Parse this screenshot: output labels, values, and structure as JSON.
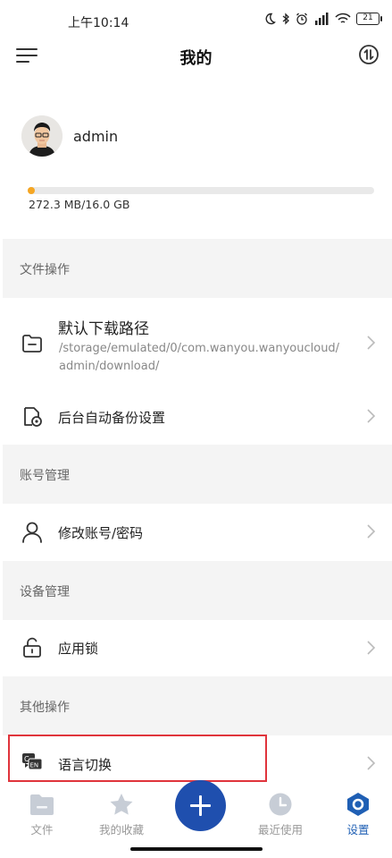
{
  "status_bar": {
    "time": "上午10:14",
    "battery": "21"
  },
  "header": {
    "title": "我的"
  },
  "profile": {
    "username": "admin"
  },
  "storage": {
    "text": "272.3 MB/16.0 GB",
    "used_fraction": 0.017,
    "fill_color": "#f5a623"
  },
  "sections": {
    "file_ops": "文件操作",
    "account": "账号管理",
    "device": "设备管理",
    "other": "其他操作"
  },
  "rows": {
    "download_path": {
      "label": "默认下载路径",
      "path_line1": "/storage/emulated/0/com.wanyou.wanyoucloud/",
      "path_line2": "admin/download/"
    },
    "backup": {
      "label": "后台自动备份设置"
    },
    "change_account": {
      "label": "修改账号/密码"
    },
    "app_lock": {
      "label": "应用锁"
    },
    "language": {
      "label": "语言切换"
    }
  },
  "bottom_nav": {
    "files": "文件",
    "favorites": "我的收藏",
    "recent": "最近使用",
    "settings": "设置",
    "active": "settings",
    "active_color": "#1f5fb4",
    "fab_color": "#1f4fae"
  },
  "highlight_color": "#e0343c"
}
